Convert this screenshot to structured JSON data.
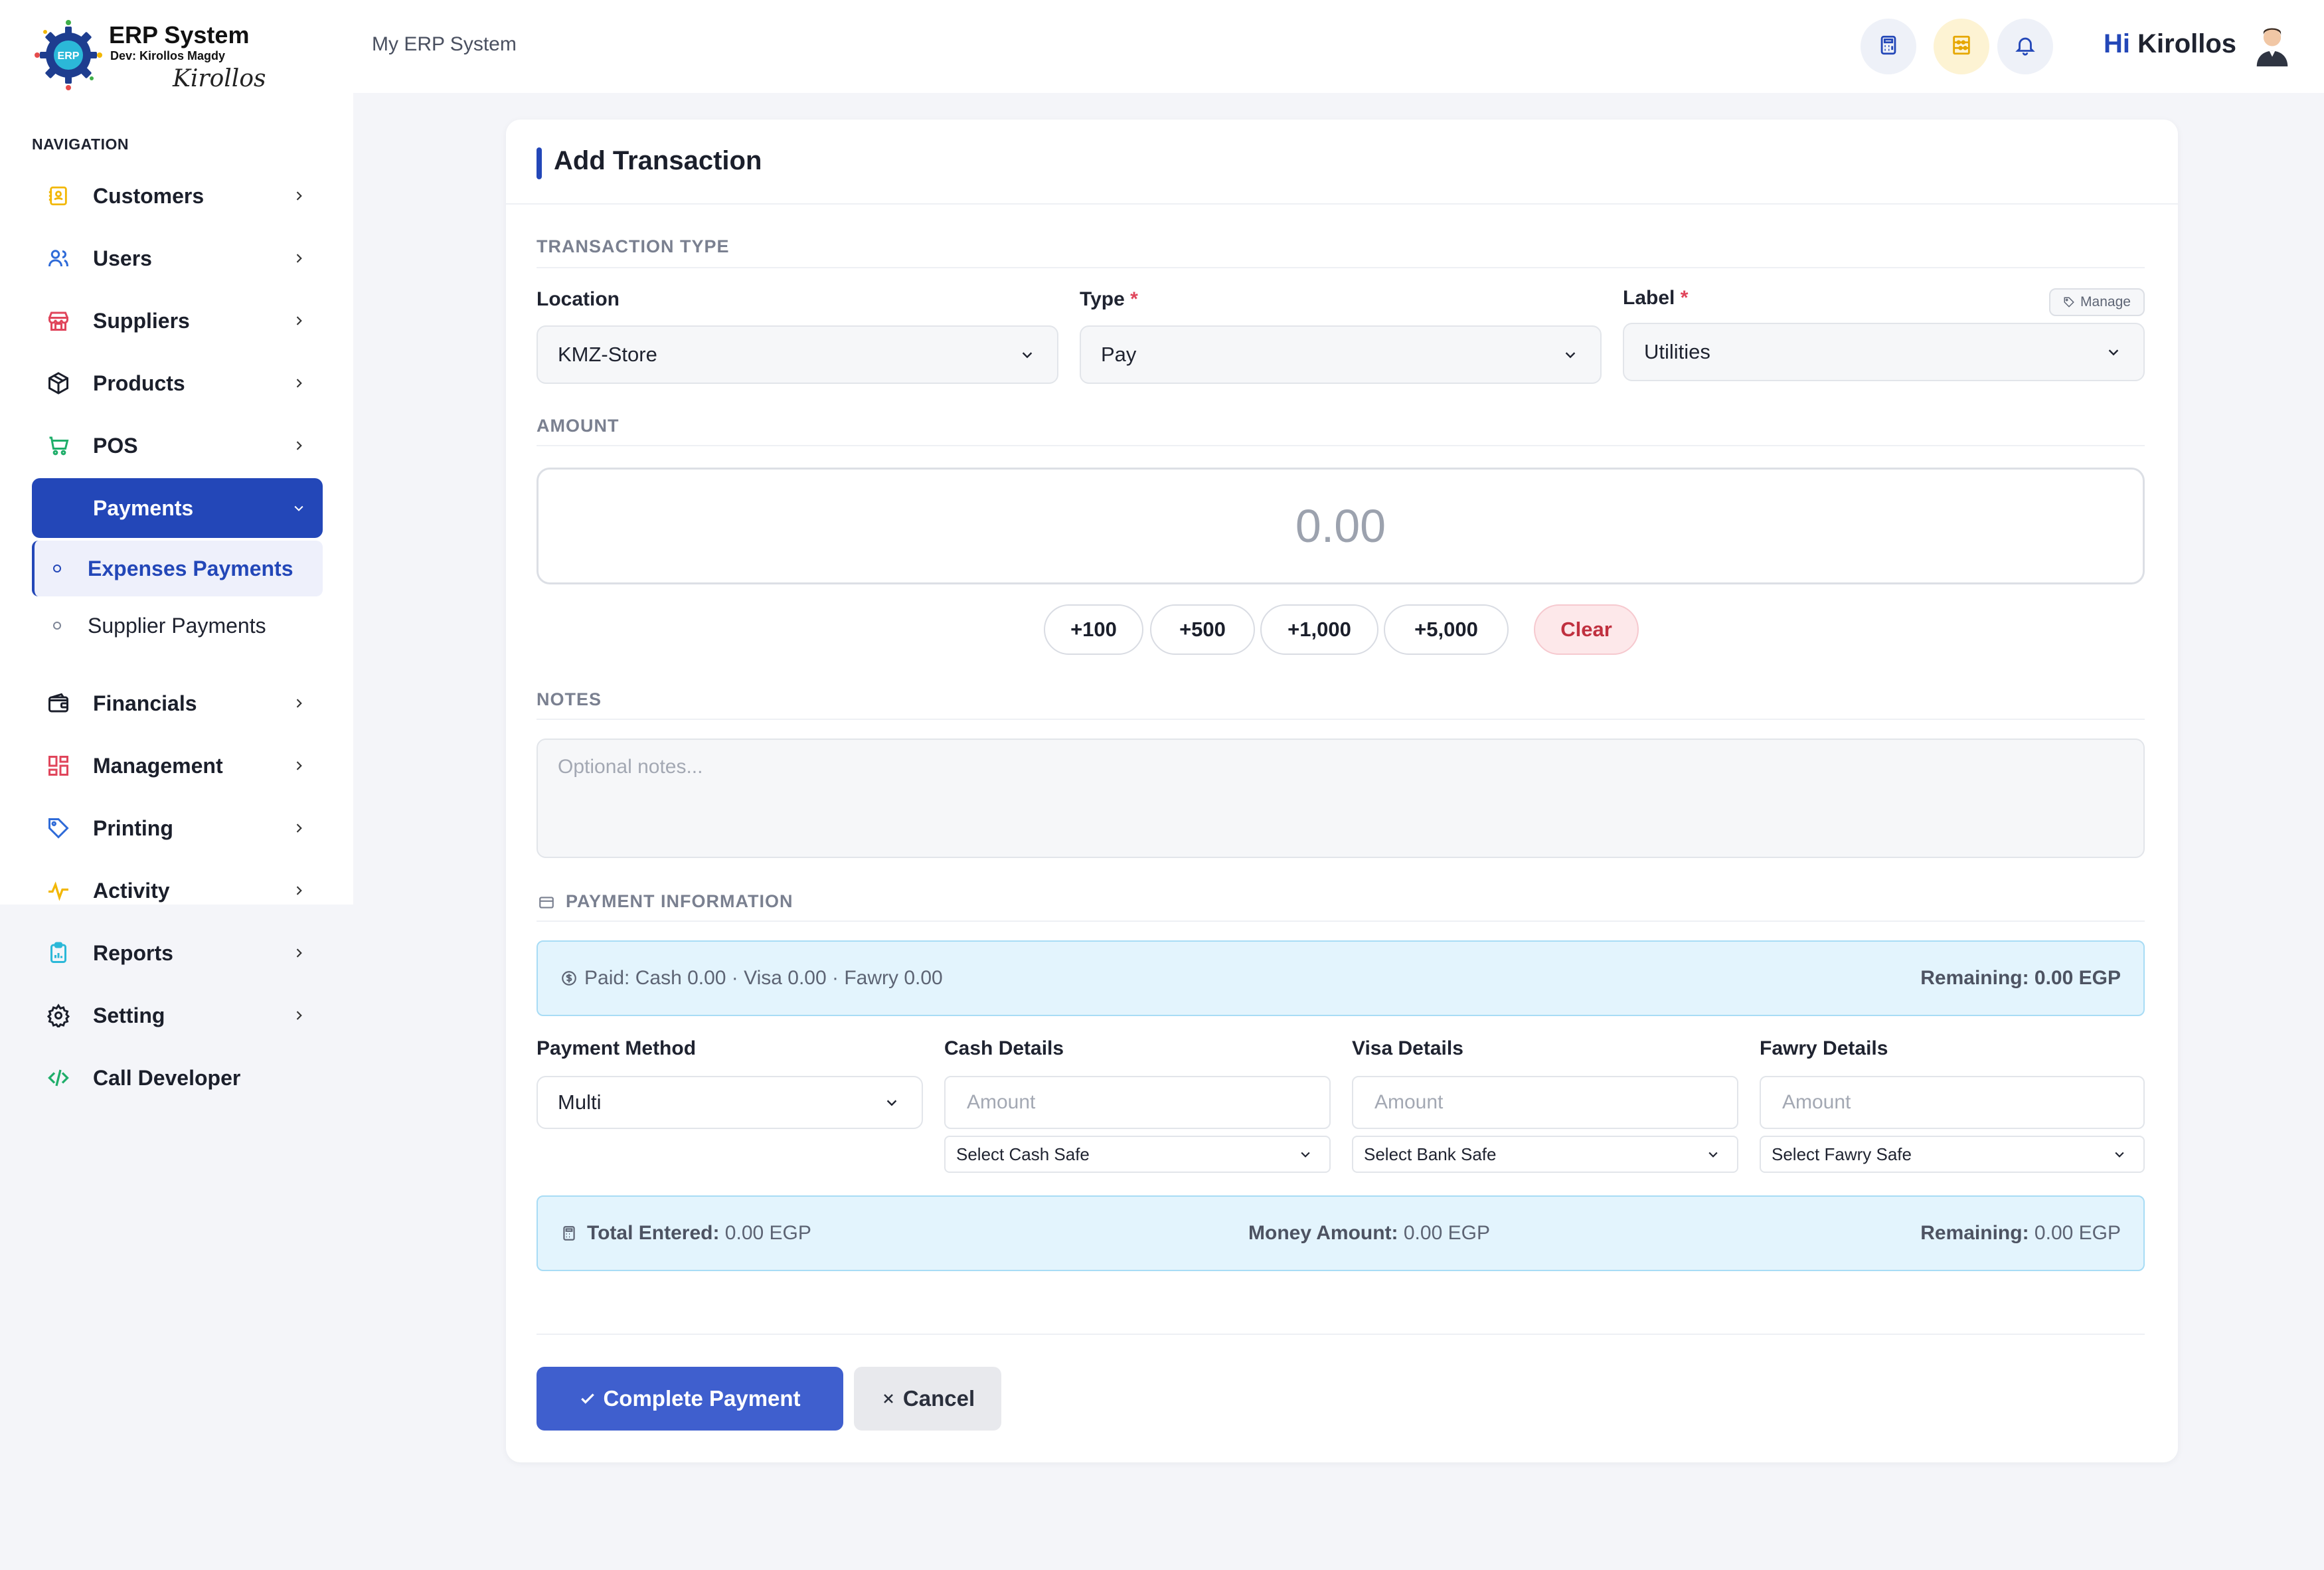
{
  "brand": {
    "title": "ERP System",
    "dev": "Dev: Kirollos Magdy",
    "signature": "Kirollos",
    "logo_text": "ERP"
  },
  "sidebar": {
    "heading": "NAVIGATION",
    "items": [
      {
        "label": "Customers",
        "icon": "contact-book-icon"
      },
      {
        "label": "Users",
        "icon": "users-icon"
      },
      {
        "label": "Suppliers",
        "icon": "store-icon"
      },
      {
        "label": "Products",
        "icon": "box-icon"
      },
      {
        "label": "POS",
        "icon": "cart-icon"
      },
      {
        "label": "Payments",
        "icon": "payments-icon"
      },
      {
        "label": "Financials",
        "icon": "wallet-icon"
      },
      {
        "label": "Management",
        "icon": "dashboard-grid-icon"
      },
      {
        "label": "Printing",
        "icon": "tag-icon"
      },
      {
        "label": "Activity",
        "icon": "activity-icon"
      },
      {
        "label": "Reports",
        "icon": "clipboard-icon"
      },
      {
        "label": "Setting",
        "icon": "gear-icon"
      },
      {
        "label": "Call Developer",
        "icon": "code-icon"
      }
    ],
    "payments_sub": [
      {
        "label": "Expenses Payments",
        "active": true
      },
      {
        "label": "Supplier Payments",
        "active": false
      }
    ]
  },
  "header": {
    "breadcrumb": "My ERP System",
    "greeting_hi": "Hi",
    "greeting_name": "Kirollos",
    "icons": [
      "calculator-icon",
      "abacus-icon",
      "bell-icon"
    ]
  },
  "form": {
    "title": "Add Transaction",
    "section_transaction_type": "TRANSACTION TYPE",
    "location_label": "Location",
    "location_value": "KMZ-Store",
    "type_label": "Type",
    "type_value": "Pay",
    "label_label": "Label",
    "label_value": "Utilities",
    "required_mark": "*",
    "manage_label": "Manage",
    "section_amount": "AMOUNT",
    "amount_value": "0.00",
    "quick_amounts": [
      "+100",
      "+500",
      "+1,000",
      "+5,000"
    ],
    "clear_label": "Clear",
    "section_notes": "NOTES",
    "notes_placeholder": "Optional notes...",
    "section_payment": "PAYMENT INFORMATION",
    "paid_summary": "Paid: Cash 0.00 · Visa 0.00 · Fawry 0.00",
    "remaining_summary": "Remaining: 0.00 EGP",
    "payment_method_label": "Payment Method",
    "payment_method_value": "Multi",
    "cash_label": "Cash Details",
    "visa_label": "Visa Details",
    "fawry_label": "Fawry Details",
    "amount_placeholder": "Amount",
    "cash_safe": "Select Cash Safe",
    "bank_safe": "Select Bank Safe",
    "fawry_safe": "Select Fawry Safe",
    "total_entered_label": "Total Entered:",
    "total_entered_value": "0.00 EGP",
    "money_amount_label": "Money Amount:",
    "money_amount_value": "0.00 EGP",
    "remaining_label": "Remaining:",
    "remaining_value": "0.00 EGP",
    "complete_label": "Complete Payment",
    "cancel_label": "Cancel"
  },
  "colors": {
    "primary": "#2347b8",
    "button_primary": "#3f5fce",
    "info_bg": "#e3f4fd",
    "clear_bg": "#fde8ea",
    "required": "#e0455b"
  }
}
